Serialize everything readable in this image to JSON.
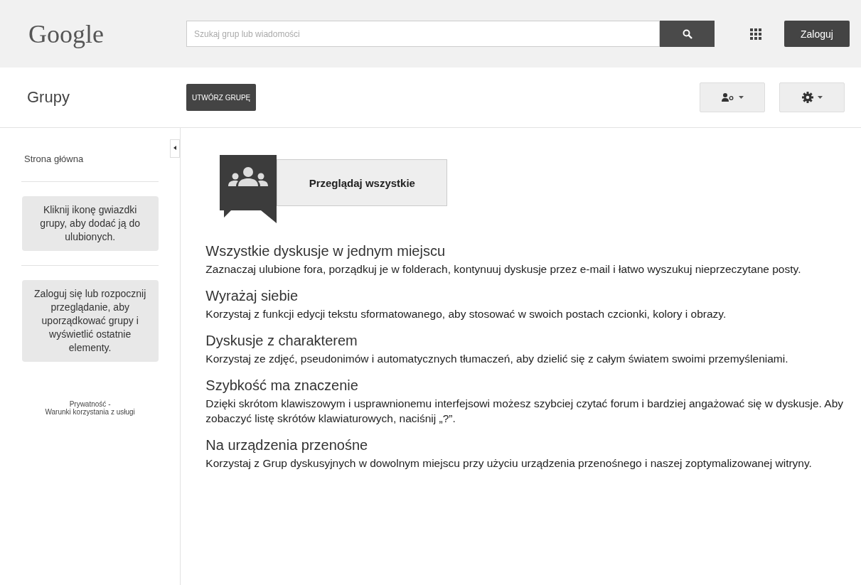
{
  "header": {
    "logo": "Google",
    "search": {
      "placeholder": "Szukaj grup lub wiadomości"
    },
    "login_button": "Zaloguj"
  },
  "toolbar": {
    "title": "Grupy",
    "create_button": "UTWÓRZ GRUPĘ"
  },
  "sidebar": {
    "home_link": "Strona główna",
    "notes": [
      "Kliknij ikonę gwiazdki grupy, aby dodać ją do ulubionych.",
      "Zaloguj się lub rozpocznij przeglądanie, aby uporządkować grupy i wyświetlić ostatnie elementy."
    ],
    "footer": {
      "links": [
        "Prywatność",
        "Warunki korzystania z usługi"
      ],
      "separator": "-"
    }
  },
  "main": {
    "browse_button": "Przeglądaj wszystkie",
    "features": [
      {
        "title": "Wszystkie dyskusje w jednym miejscu",
        "text": "Zaznaczaj ulubione fora, porządkuj je w folderach, kontynuuj dyskusje przez e-mail i łatwo wyszukuj nieprzeczytane posty."
      },
      {
        "title": "Wyrażaj siebie",
        "text": "Korzystaj z funkcji edycji tekstu sformatowanego, aby stosować w swoich postach czcionki, kolory i obrazy."
      },
      {
        "title": "Dyskusje z charakterem",
        "text": "Korzystaj ze zdjęć, pseudonimów i automatycznych tłumaczeń, aby dzielić się z całym światem swoimi przemyśleniami."
      },
      {
        "title": "Szybkość ma znaczenie",
        "text": "Dzięki skrótom klawiszowym i usprawnionemu interfejsowi możesz szybciej czytać forum i bardziej angażować się w dyskusje. Aby zobaczyć listę skrótów klawiaturowych, naciśnij „?”."
      },
      {
        "title": "Na urządzenia przenośne",
        "text": "Korzystaj z Grup dyskusyjnych w dowolnym miejscu przy użyciu urządzenia przenośnego i naszej zoptymalizowanej witryny."
      }
    ]
  }
}
